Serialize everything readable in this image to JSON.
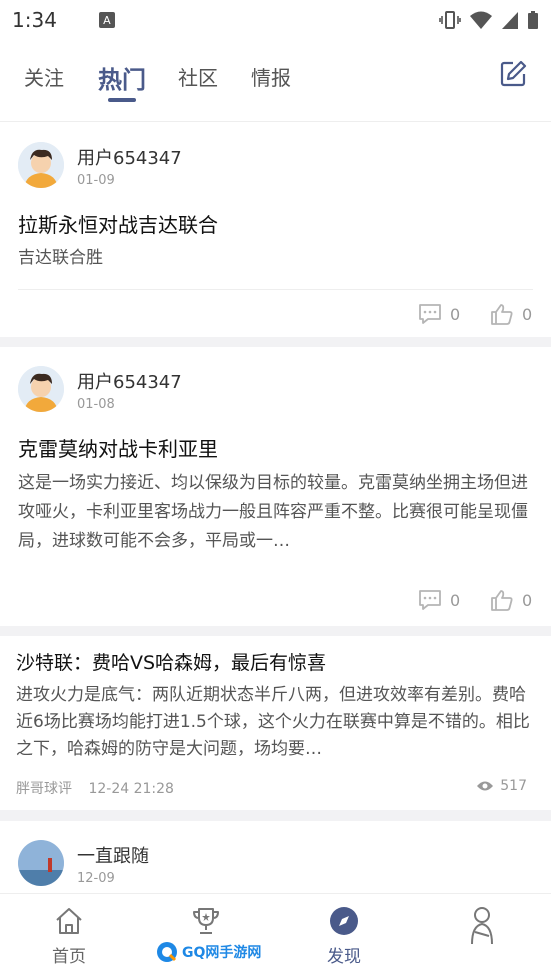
{
  "status_bar": {
    "time": "1:34",
    "notif_letter": "A"
  },
  "tabs": [
    {
      "label": "关注"
    },
    {
      "label": "热门"
    },
    {
      "label": "社区"
    },
    {
      "label": "情报"
    }
  ],
  "posts": [
    {
      "username": "用户654347",
      "date": "01-09",
      "title": "拉斯永恒对战吉达联合",
      "body": "吉达联合胜",
      "comments": "0",
      "likes": "0"
    },
    {
      "username": "用户654347",
      "date": "01-08",
      "title": "克雷莫纳对战卡利亚里",
      "body": "这是一场实力接近、均以保级为目标的较量。克雷莫纳坐拥主场但进攻哑火，卡利亚里客场战力一般且阵容严重不整。比赛很可能呈现僵局，进球数可能不会多，平局或一…",
      "comments": "0",
      "likes": "0"
    }
  ],
  "article": {
    "title": "沙特联：费哈VS哈森姆，最后有惊喜",
    "body": "进攻火力是底气：两队近期状态半斤八两，但进攻效率有差别。费哈近6场比赛场均能打进1.5个球，这个火力在联赛中算是不错的。相比之下，哈森姆的防守是大问题，场均要…",
    "author": "胖哥球评",
    "time": "12-24 21:28",
    "views": "517"
  },
  "post3": {
    "username": "一直跟随",
    "date": "12-09"
  },
  "bottom_nav": [
    {
      "label": "首页",
      "icon": "home-icon"
    },
    {
      "label": "",
      "icon": "trophy-icon"
    },
    {
      "label": "发现",
      "icon": "compass-icon"
    },
    {
      "label": "",
      "icon": "profile-icon"
    }
  ],
  "watermark": {
    "text": "GQ网手游网"
  },
  "colors": {
    "accent": "#4a5a8a",
    "text_secondary": "#999999",
    "divider": "#f2f2f4"
  }
}
